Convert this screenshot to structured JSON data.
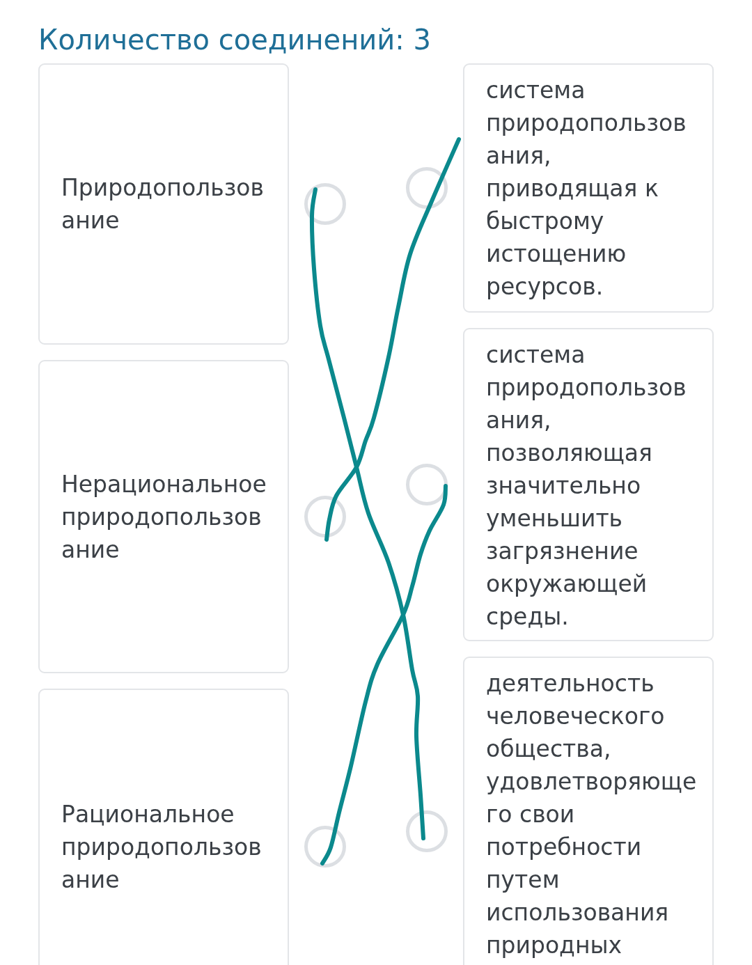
{
  "title": "Количество соединений: 3",
  "left_items": [
    {
      "text": "Природопользование"
    },
    {
      "text": "Нерациональное природопользование"
    },
    {
      "text": "Рациональное природопользование"
    }
  ],
  "right_items": [
    {
      "text": "система природопользования, приводящая к быстрому истощению ресурсов."
    },
    {
      "text": "система природопользования, позволяющая значительно уменьшить загрязнение окружающей среды."
    },
    {
      "text": "деятельность человеческого общества, удовлетворяющего свои потребности путем использования природных"
    }
  ]
}
